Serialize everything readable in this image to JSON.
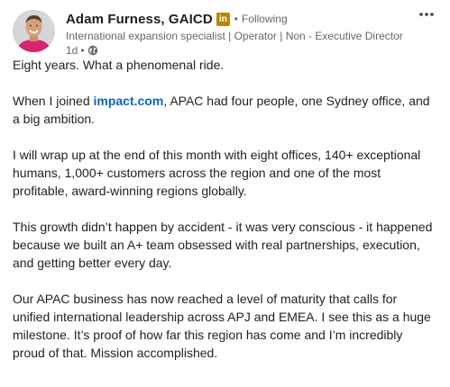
{
  "post": {
    "author": {
      "name": "Adam Furness, GAICD",
      "badge": "in",
      "follow_status": "Following",
      "headline": "International expansion specialist | Operator | Non - Executive Director",
      "time": "1d",
      "visibility_icon": "globe-icon"
    },
    "more_icon": "more-horizontal-icon",
    "colors": {
      "link": "#0a66c2",
      "badge": "#b8860b",
      "meta_text": "#666666"
    },
    "body": {
      "p1": "Eight years. What a phenomenal ride.",
      "p2_pre": "When I joined ",
      "p2_link": "impact.com",
      "p2_post": ", APAC had four people, one Sydney office, and a big ambition.",
      "p3": "I will wrap up at the end of this month with eight offices, 140+ exceptional humans, 1,000+ customers across the region and one of the most profitable, award-winning regions globally.",
      "p4": "This growth didn’t happen by accident - it was very conscious - it happened because we built an A+ team obsessed with real partnerships, execution, and getting better every day.",
      "p5": "Our APAC business has now reached a level of maturity that calls for unified international leadership across APJ and EMEA. I see this as a huge milestone. It’s proof of how far this region has come and I’m incredibly proud of that. Mission accomplished."
    }
  }
}
